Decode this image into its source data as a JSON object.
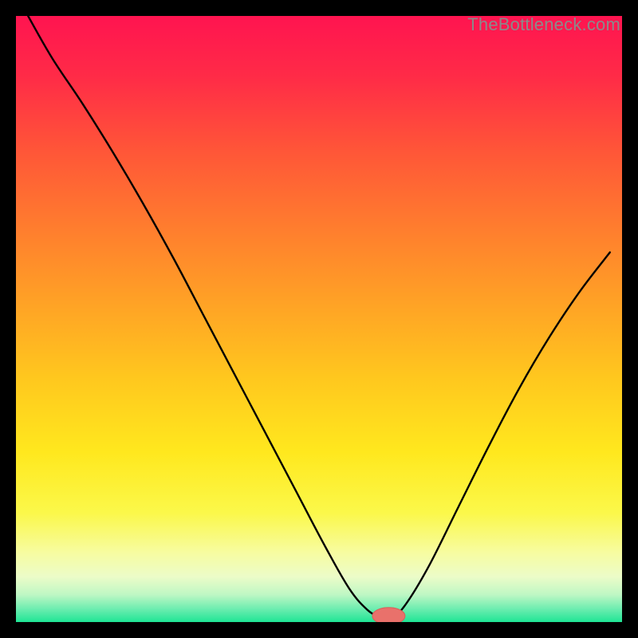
{
  "watermark": "TheBottleneck.com",
  "colors": {
    "background": "#000000",
    "curve": "#000000",
    "marker_fill": "#e9716b",
    "marker_stroke": "#d85f59",
    "gradient_stops": [
      {
        "offset": 0.0,
        "color": "#ff1450"
      },
      {
        "offset": 0.1,
        "color": "#ff2b47"
      },
      {
        "offset": 0.22,
        "color": "#ff5538"
      },
      {
        "offset": 0.35,
        "color": "#ff7d2e"
      },
      {
        "offset": 0.48,
        "color": "#ffa425"
      },
      {
        "offset": 0.6,
        "color": "#ffc81e"
      },
      {
        "offset": 0.72,
        "color": "#ffe81e"
      },
      {
        "offset": 0.82,
        "color": "#fbf84a"
      },
      {
        "offset": 0.885,
        "color": "#f7fca0"
      },
      {
        "offset": 0.925,
        "color": "#ecfcc8"
      },
      {
        "offset": 0.955,
        "color": "#bef7c4"
      },
      {
        "offset": 0.978,
        "color": "#6eedb0"
      },
      {
        "offset": 1.0,
        "color": "#1fe595"
      }
    ]
  },
  "chart_data": {
    "type": "line",
    "title": "",
    "xlabel": "",
    "ylabel": "",
    "xlim": [
      0,
      100
    ],
    "ylim": [
      0,
      100
    ],
    "series": [
      {
        "name": "bottleneck-curve",
        "x": [
          2,
          6,
          11,
          16,
          21,
          26,
          31,
          36,
          41,
          46,
          51,
          55,
          58,
          60,
          62,
          64,
          68,
          73,
          78,
          83,
          88,
          93,
          98
        ],
        "y": [
          100,
          93,
          85.5,
          77.5,
          69,
          60,
          50.5,
          41,
          31.5,
          22,
          12.5,
          5.5,
          2,
          1,
          1,
          2.5,
          9,
          19,
          29,
          38.5,
          47,
          54.5,
          61
        ]
      }
    ],
    "marker": {
      "x": 61.5,
      "y": 1,
      "rx": 2.7,
      "ry": 1.4
    }
  }
}
